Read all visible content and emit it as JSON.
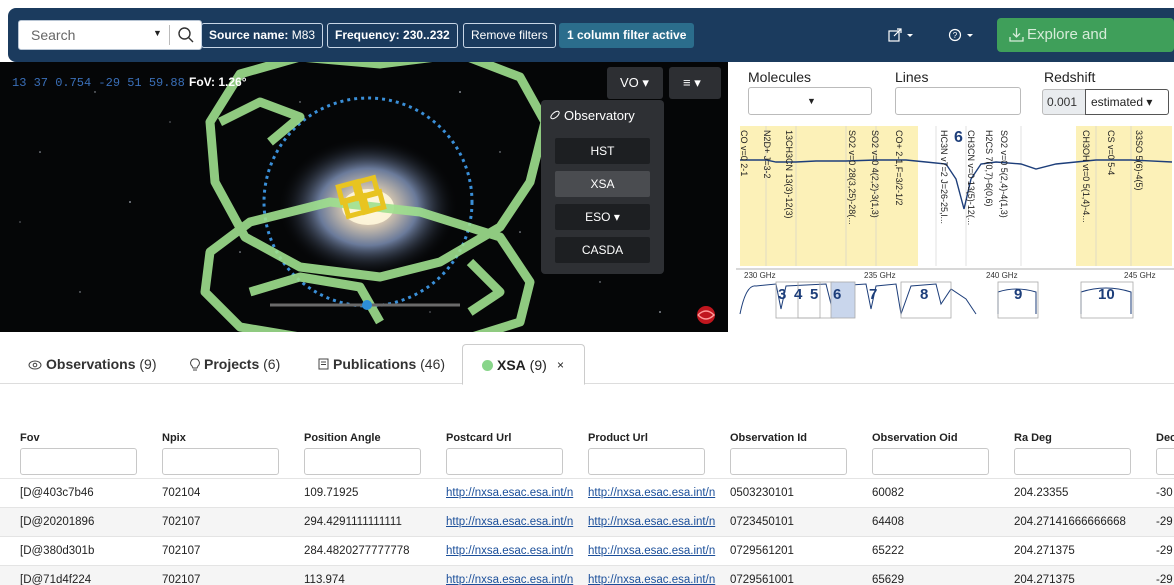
{
  "toolbar": {
    "search_placeholder": "Search",
    "filters": [
      {
        "key": "Source name:",
        "value": " M83"
      },
      {
        "key": "Frequency:",
        "value": " 230..232"
      }
    ],
    "remove_filters": "Remove filters",
    "active_filters": "1 column filter active",
    "explore_button": "Explore and download"
  },
  "sky": {
    "coordinates": "13 37 0.754 -29 51 59.88",
    "fov": "FoV: 1.26°",
    "vo_button": "VO ▾",
    "menu_button": "≡ ▾",
    "observatory": {
      "title": "Observatory",
      "buttons": [
        "HST",
        "XSA",
        "ESO ▾",
        "CASDA"
      ],
      "selected": "XSA"
    }
  },
  "spectrum": {
    "molecules_label": "Molecules",
    "lines_label": "Lines",
    "redshift_label": "Redshift",
    "redshift_value": "0.001",
    "redshift_mode": "estimated ▾",
    "big_label": "6",
    "line_labels": [
      "CO v=0 2-1",
      "N2D+ J=3-2",
      "13CH3CN 13(3)-12(3)",
      "SO2 v=0 28(3,25)-28(...",
      "SO2 v=0 4(2,2)-3(1,3)",
      "CO+ 2-1,F=3/2-1/2",
      "HC3N v7=2 J=26-25,l...",
      "CH3CN v=0 13(5)-12(...",
      "H2CS 7(0,7)-6(0,6)",
      "SO2 v=0 5(2,4)-4(1,3)",
      "CH3OH vt=0 5(1,4)-4...",
      "CS v=0 5-4",
      "33SO 5(6)-4(5)"
    ],
    "axis_ticks": [
      "230 GHz",
      "235 GHz",
      "240 GHz",
      "245 GHz"
    ],
    "window_numbers": [
      "3",
      "4",
      "5",
      "6",
      "7",
      "8",
      "9",
      "10"
    ]
  },
  "tabs": [
    {
      "icon": "eye-icon",
      "label": "Observations",
      "count": " (9)"
    },
    {
      "icon": "lightbulb-icon",
      "label": "Projects",
      "count": " (6)"
    },
    {
      "icon": "document-icon",
      "label": "Publications",
      "count": " (46)"
    }
  ],
  "active_tab": {
    "label": "XSA",
    "count": " (9)",
    "close": "×"
  },
  "table": {
    "columns": [
      "Fov",
      "Npix",
      "Position Angle",
      "Postcard Url",
      "Product Url",
      "Observation Id",
      "Observation Oid",
      "Ra Deg",
      "Dec"
    ],
    "rows": [
      [
        "[D@403c7b46",
        "702104",
        "109.71925",
        "http://nxsa.esac.esa.int/n",
        "http://nxsa.esac.esa.int/n",
        "0503230101",
        "60082",
        "204.23355",
        "-30"
      ],
      [
        "[D@20201896",
        "702107",
        "294.4291111111111",
        "http://nxsa.esac.esa.int/n",
        "http://nxsa.esac.esa.int/n",
        "0723450101",
        "64408",
        "204.27141666666668",
        "-29"
      ],
      [
        "[D@380d301b",
        "702107",
        "284.4820277777778",
        "http://nxsa.esac.esa.int/n",
        "http://nxsa.esac.esa.int/n",
        "0729561201",
        "65222",
        "204.271375",
        "-29"
      ],
      [
        "[D@71d4f224",
        "702107",
        "113.974",
        "http://nxsa.esac.esa.int/n",
        "http://nxsa.esac.esa.int/n",
        "0729561001",
        "65629",
        "204.271375",
        "-29"
      ]
    ]
  }
}
